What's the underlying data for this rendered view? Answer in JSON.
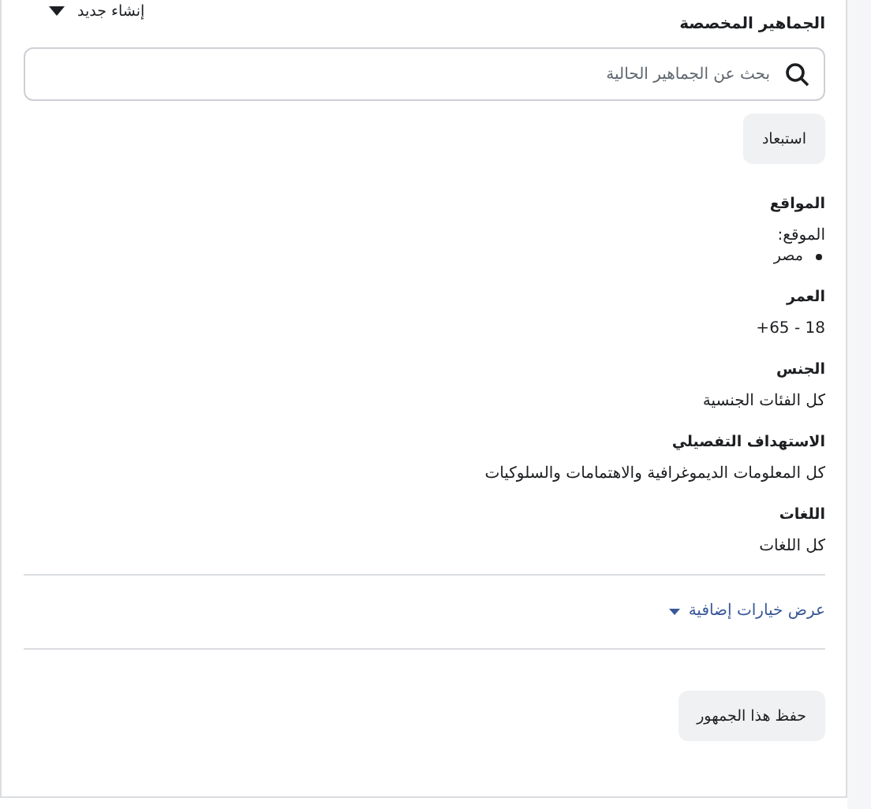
{
  "header": {
    "title": "الجماهير المخصصة",
    "create_menu": "إنشاء جديد"
  },
  "search": {
    "placeholder": "بحث عن الجماهير الحالية"
  },
  "exclude_button": "استبعاد",
  "sections": [
    {
      "kind": "list",
      "heading": "المواقع",
      "label": "الموقع:",
      "items": [
        "مصر"
      ]
    },
    {
      "kind": "text",
      "heading": "العمر",
      "value": "18 - 65+"
    },
    {
      "kind": "text",
      "heading": "الجنس",
      "value": "كل الفئات الجنسية"
    },
    {
      "kind": "text",
      "heading": "الاستهداف التفصيلي",
      "value": "كل المعلومات الديموغرافية والاهتمامات والسلوكيات"
    },
    {
      "kind": "text",
      "heading": "اللغات",
      "value": "كل اللغات"
    }
  ],
  "more_options_link": "عرض خيارات إضافية",
  "save_button": "حفظ هذا الجمهور"
}
